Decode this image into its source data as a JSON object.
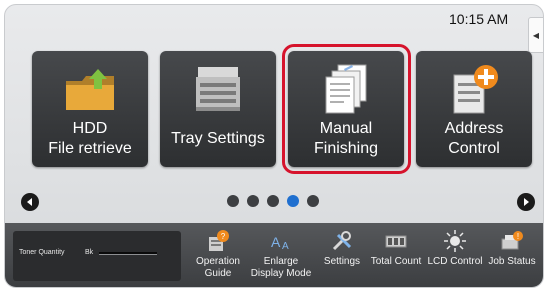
{
  "status_bar": {
    "time": "10:15 AM"
  },
  "tiles": [
    {
      "line1": "HDD",
      "line2": "File retrieve"
    },
    {
      "line1": "Tray Settings",
      "line2": ""
    },
    {
      "line1": "Manual",
      "line2": "Finishing"
    },
    {
      "line1": "Address",
      "line2": "Control"
    }
  ],
  "pager": {
    "pages": 5,
    "active_page": 4
  },
  "bottom_bar": {
    "toner_label": "Toner Quantity",
    "toner_color": "Bk",
    "items": [
      {
        "line1": "Operation",
        "line2": "Guide"
      },
      {
        "line1": "Enlarge",
        "line2": "Display Mode"
      },
      {
        "line1": "Settings",
        "line2": ""
      },
      {
        "line1": "Total Count",
        "line2": ""
      },
      {
        "line1": "LCD Control",
        "line2": ""
      },
      {
        "line1": "Job Status",
        "line2": ""
      }
    ]
  },
  "colors": {
    "highlight": "#d6132c",
    "active_dot": "#1f6fcf",
    "tile": "#3a3c3f"
  }
}
